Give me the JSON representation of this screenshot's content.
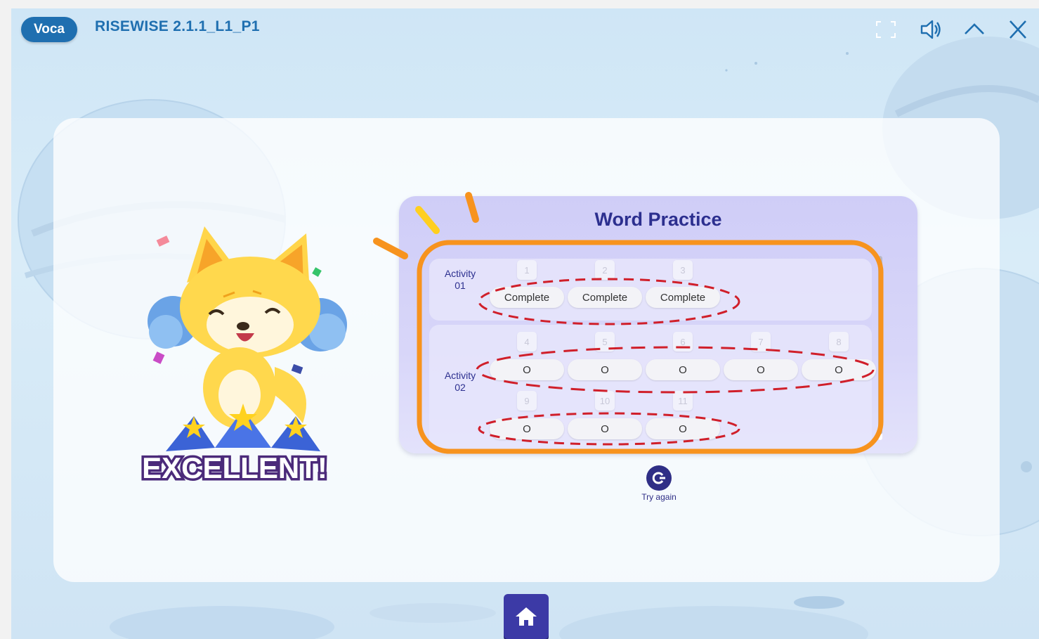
{
  "header": {
    "badge": "Voca",
    "title": "RISEWISE 2.1.1_L1_P1",
    "icons": [
      "fullscreen-icon",
      "speaker-icon",
      "chevron-up-icon",
      "close-icon"
    ]
  },
  "mascot": {
    "caption": "EXCELLENT!"
  },
  "practice": {
    "title": "Word Practice",
    "activities": [
      {
        "label_line1": "Activity",
        "label_line2": "01",
        "items": [
          {
            "num": "1",
            "status": "Complete"
          },
          {
            "num": "2",
            "status": "Complete"
          },
          {
            "num": "3",
            "status": "Complete"
          }
        ]
      },
      {
        "label_line1": "Activity",
        "label_line2": "02",
        "items": [
          {
            "num": "4",
            "status": "O"
          },
          {
            "num": "5",
            "status": "O"
          },
          {
            "num": "6",
            "status": "O"
          },
          {
            "num": "7",
            "status": "O"
          },
          {
            "num": "8",
            "status": "O"
          },
          {
            "num": "9",
            "status": "O"
          },
          {
            "num": "10",
            "status": "O"
          },
          {
            "num": "11",
            "status": "O"
          }
        ]
      }
    ]
  },
  "actions": {
    "try_again": "Try again",
    "home_icon": "home-icon"
  },
  "colors": {
    "brand_blue": "#1f6fb0",
    "navy": "#2c2f8f",
    "highlight_orange": "#f7931e",
    "annotation_red": "#d01f2a"
  }
}
